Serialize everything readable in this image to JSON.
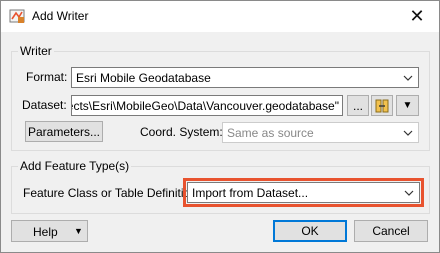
{
  "window": {
    "title": "Add Writer",
    "close_glyph": "✕"
  },
  "writer_group": {
    "title": "Writer",
    "format_label": "Format:",
    "format_value": "Esri Mobile Geodatabase",
    "dataset_label": "Dataset:",
    "dataset_value": "Projects\\Esri\\MobileGeo\\Data\\Vancouver.geodatabase\"",
    "browse_label": "...",
    "dropdown_glyph": "▼",
    "parameters_label": "Parameters...",
    "coord_label": "Coord. System:",
    "coord_value": "Same as source"
  },
  "feature_group": {
    "title": "Add Feature Type(s)",
    "definition_label": "Feature Class or Table Definition:",
    "definition_value": "Import from Dataset..."
  },
  "footer": {
    "help_label": "Help",
    "help_arrow": "▼",
    "ok_label": "OK",
    "cancel_label": "Cancel"
  },
  "icons": {
    "app": "fme-writer-icon",
    "close": "close-icon",
    "dataset_options": "reader-writer-icon",
    "chevron": "chevron-down-icon"
  },
  "colors": {
    "highlight": "#e8532f",
    "default_button_border": "#0078d7"
  }
}
